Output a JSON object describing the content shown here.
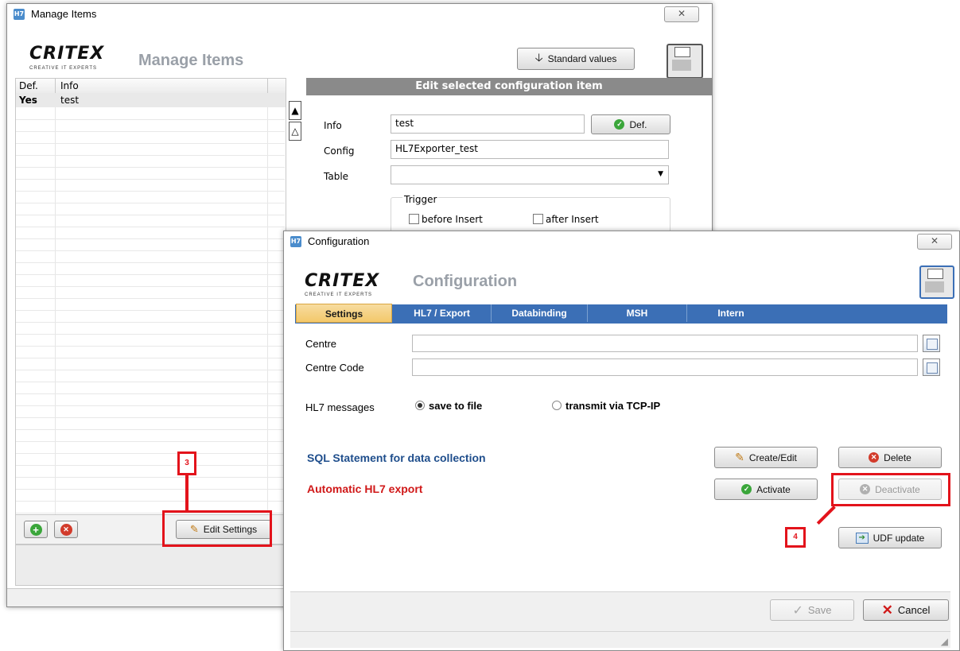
{
  "manage": {
    "window_title": "Manage Items",
    "close_glyph": "✕",
    "logo_text": "CRITEX",
    "logo_sub": "CREATIVE IT EXPERTS",
    "header_title": "Manage Items",
    "standard_values_label": "Standard values",
    "grid": {
      "columns": [
        "Def.",
        "Info"
      ],
      "rows": [
        {
          "def": "Yes",
          "info": "test"
        }
      ]
    },
    "edit_header": "Edit selected configuration item",
    "info_label": "Info",
    "info_value": "test",
    "def_button_label": "Def.",
    "config_label": "Config",
    "config_value": "HL7Exporter_test",
    "table_label": "Table",
    "table_value": "",
    "trigger_label": "Trigger",
    "before_insert_label": "before Insert",
    "after_insert_label": "after Insert",
    "edit_settings_label": "Edit Settings"
  },
  "config": {
    "window_title": "Configuration",
    "close_glyph": "✕",
    "logo_text": "CRITEX",
    "logo_sub": "CREATIVE IT EXPERTS",
    "header_title": "Configuration",
    "tabs": [
      "Settings",
      "HL7 / Export",
      "Databinding",
      "MSH",
      "Intern"
    ],
    "active_tab": "Settings",
    "centre_label": "Centre",
    "centre_value": "",
    "centre_code_label": "Centre Code",
    "centre_code_value": "",
    "hl7_messages_label": "HL7 messages",
    "radio_save_label": "save to file",
    "radio_tcp_label": "transmit via TCP-IP",
    "radio_selected": "save to file",
    "sql_label": "SQL Statement for data collection",
    "auto_label": "Automatic HL7 export",
    "create_edit_label": "Create/Edit",
    "delete_label": "Delete",
    "activate_label": "Activate",
    "deactivate_label": "Deactivate",
    "udf_label": "UDF update",
    "save_label": "Save",
    "cancel_label": "Cancel"
  },
  "annotations": {
    "marker3": "3",
    "marker4": "4"
  },
  "colors": {
    "tab_bar": "#3b6fb6",
    "active_tab": "#f3c86a",
    "sql_text": "#1f4e8c",
    "auto_text": "#d01818",
    "marker": "#e3131b"
  }
}
